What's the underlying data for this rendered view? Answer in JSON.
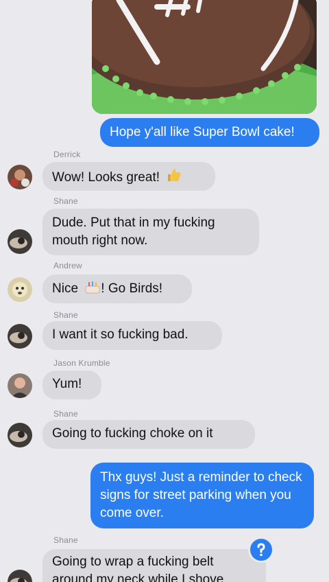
{
  "messages": {
    "m1": {
      "text": "Hope y'all like Super Bowl cake!"
    },
    "m2": {
      "sender": "Derrick",
      "text": "Wow! Looks great!"
    },
    "m3": {
      "sender": "Shane",
      "text": "Dude. Put that in my fucking mouth right now."
    },
    "m4": {
      "sender": "Andrew",
      "before": "Nice",
      "after": "! Go Birds!"
    },
    "m5": {
      "sender": "Shane",
      "text": "I want it so fucking bad."
    },
    "m6": {
      "sender": "Jason Krumble",
      "text": "Yum!"
    },
    "m7": {
      "sender": "Shane",
      "text": "Going to fucking choke on it"
    },
    "m8": {
      "text": "Thx guys! Just a reminder to check signs for street parking when you come over."
    },
    "m9": {
      "sender": "Shane",
      "text": "Going to wrap a fucking belt around my neck while I shove"
    }
  },
  "icons": {
    "thumbs_up": "thumbs-up-emoji",
    "cake": "birthday-cake-emoji",
    "reaction": "question-mark-tapback"
  },
  "colors": {
    "background": "#e9e9ee",
    "incoming_bubble": "#d9d9de",
    "outgoing_bubble": "#2b7ef0"
  }
}
